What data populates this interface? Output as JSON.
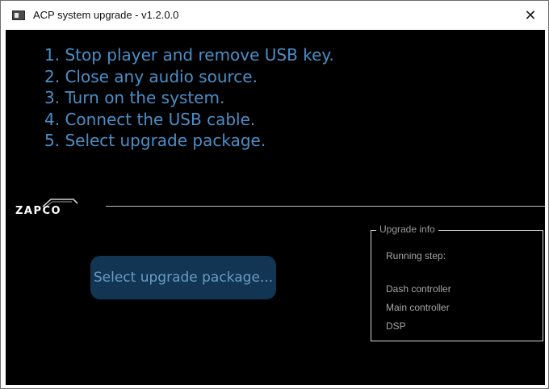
{
  "window": {
    "title": "ACP system upgrade - v1.2.0.0",
    "close_label": "✕"
  },
  "steps": [
    "1. Stop player and remove USB key.",
    "2. Close any audio source.",
    "3. Turn on the system.",
    "4. Connect the USB cable.",
    "5. Select upgrade package."
  ],
  "logo": {
    "text": "ZAPCO",
    "icon": "zapco-logo"
  },
  "select_button": {
    "label": "Select upgrade package..."
  },
  "upgrade_info": {
    "legend": "Upgrade info",
    "running_step": "Running step:",
    "components": [
      "Dash controller",
      "Main controller",
      "DSP"
    ]
  },
  "colors": {
    "background": "#000000",
    "step_text": "#4a8fc9",
    "button_bg": "#123553",
    "button_text": "#6a9bc2",
    "info_text": "#a6a6a6"
  }
}
